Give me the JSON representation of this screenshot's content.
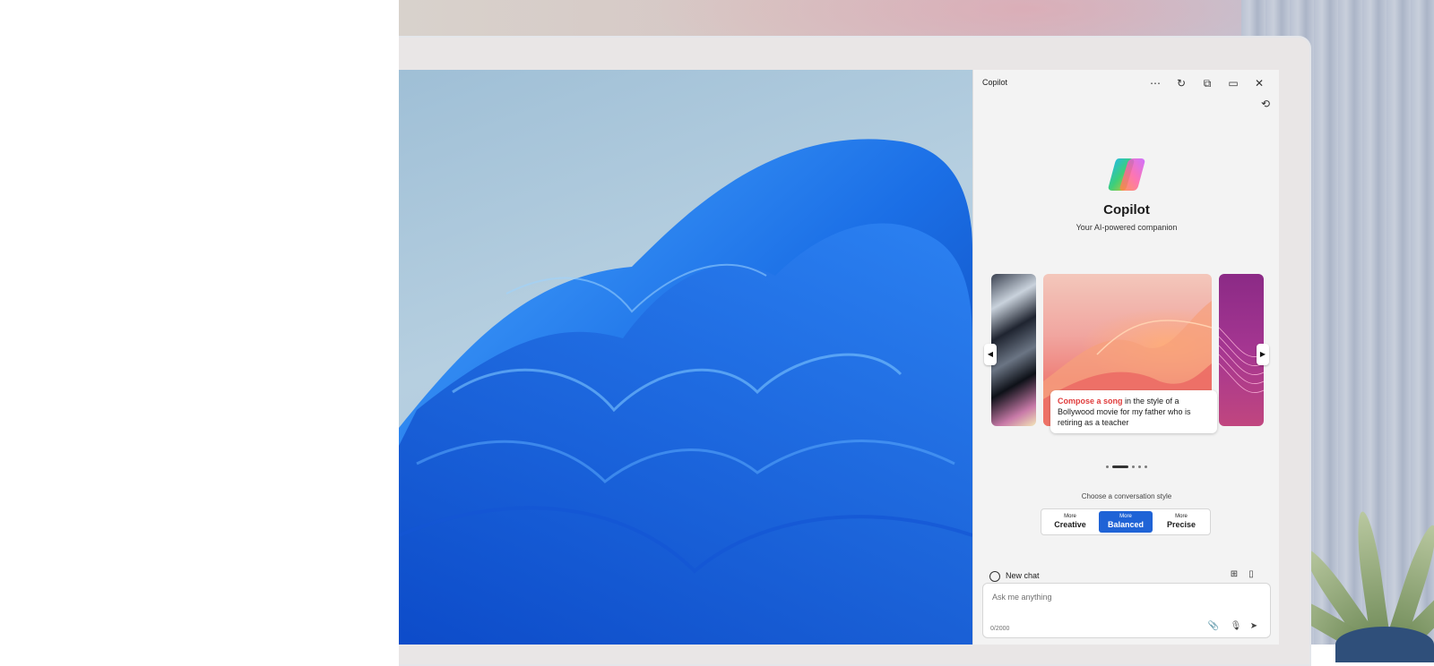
{
  "copilot_window": {
    "title": "Copilot",
    "controls": {
      "more_icon": "⋯",
      "refresh_icon": "↻",
      "open_new_icon": "⧉",
      "dock_icon": "▭",
      "close_icon": "✕"
    },
    "history_icon": "⟲"
  },
  "hero": {
    "name": "Copilot",
    "tagline": "Your AI-powered companion"
  },
  "carousel": {
    "caption_highlight": "Compose a song",
    "caption_rest": " in the style of a Bollywood movie for my father who is retiring as a teacher",
    "prev_icon": "◀",
    "next_icon": "▶",
    "active_index": 1,
    "page_count": 5
  },
  "conversation_style": {
    "label": "Choose a conversation style",
    "options": [
      {
        "small": "More",
        "big": "Creative",
        "selected": false
      },
      {
        "small": "More",
        "big": "Balanced",
        "selected": true
      },
      {
        "small": "More",
        "big": "Precise",
        "selected": false
      }
    ]
  },
  "composer": {
    "new_chat_label": "New chat",
    "placeholder": "Ask me anything",
    "counter": "0/2000",
    "attach_icon": "📎",
    "mic_icon": "🎙",
    "send_icon": "➤",
    "plugins_icon": "⊞",
    "notebook_icon": "▯"
  },
  "colors": {
    "accent": "#1f63d6",
    "highlight_text": "#e03c3c"
  }
}
